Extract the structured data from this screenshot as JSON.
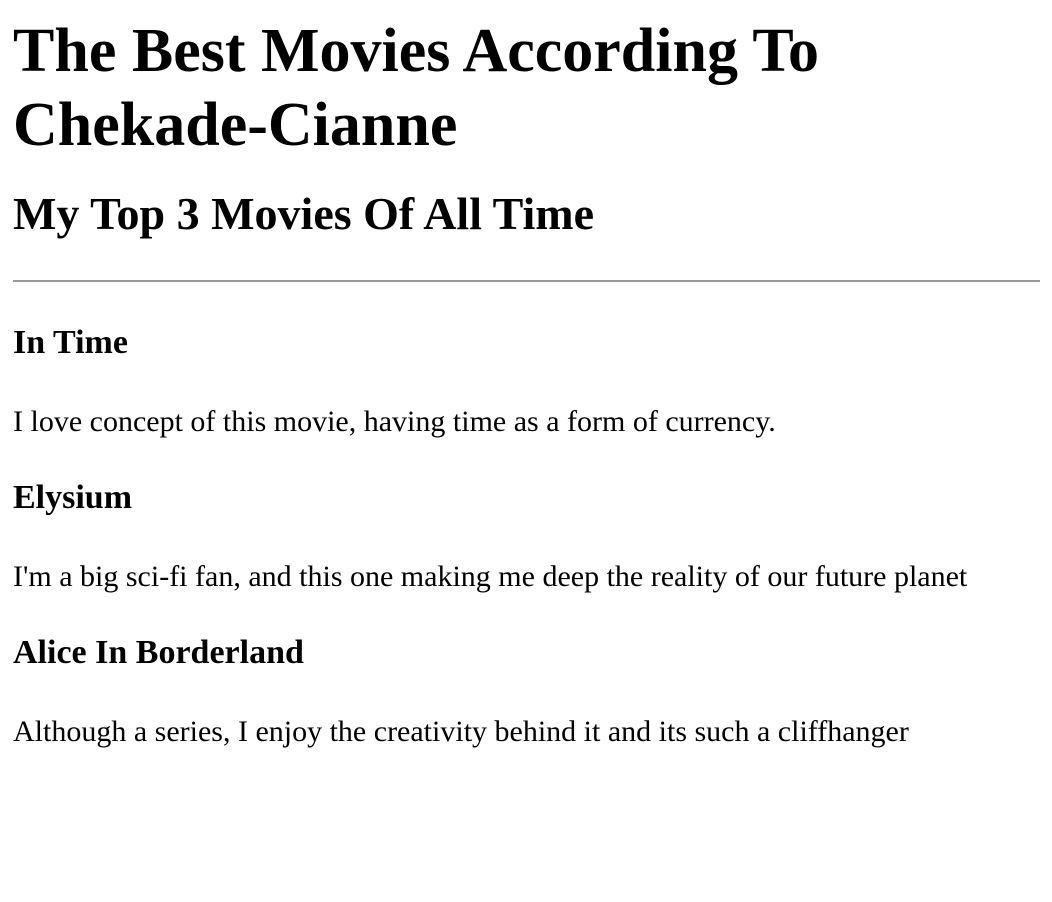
{
  "header": {
    "title": "The Best Movies According To Chekade-Cianne",
    "subtitle": "My Top 3 Movies Of All Time"
  },
  "movies": [
    {
      "title": "In Time",
      "description": "I love concept of this movie, having time as a form of currency."
    },
    {
      "title": "Elysium",
      "description": "I'm a big sci-fi fan, and this one making me deep the reality of our future planet"
    },
    {
      "title": "Alice In Borderland",
      "description": "Although a series, I enjoy the creativity behind it and its such a cliffhanger"
    }
  ]
}
